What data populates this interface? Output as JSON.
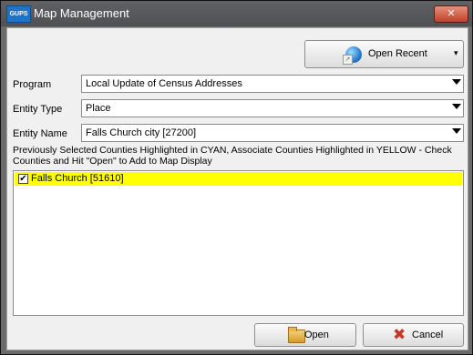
{
  "window": {
    "title": "Map Management",
    "app_icon_text": "GUPS",
    "close_symbol": "✕"
  },
  "toolbar": {
    "open_recent_label": "Open Recent",
    "open_recent_caret": "▾",
    "open_recent_icon": "globe-icon"
  },
  "form": {
    "program": {
      "label": "Program",
      "value": "Local Update of Census Addresses"
    },
    "entity_type": {
      "label": "Entity Type",
      "value": "Place"
    },
    "entity_name": {
      "label": "Entity Name",
      "value": "Falls Church city [27200]"
    }
  },
  "instructions": "Previously Selected Counties Highlighted in CYAN, Associate Counties Highlighted in YELLOW - Check Counties and Hit \"Open\" to Add to Map Display",
  "counties": [
    {
      "label": "Falls Church [51610]",
      "checked": true,
      "check_glyph": "✔",
      "highlight": "#ffff00"
    }
  ],
  "buttons": {
    "open_label": "Open",
    "cancel_label": "Cancel",
    "cancel_glyph": "✖"
  }
}
